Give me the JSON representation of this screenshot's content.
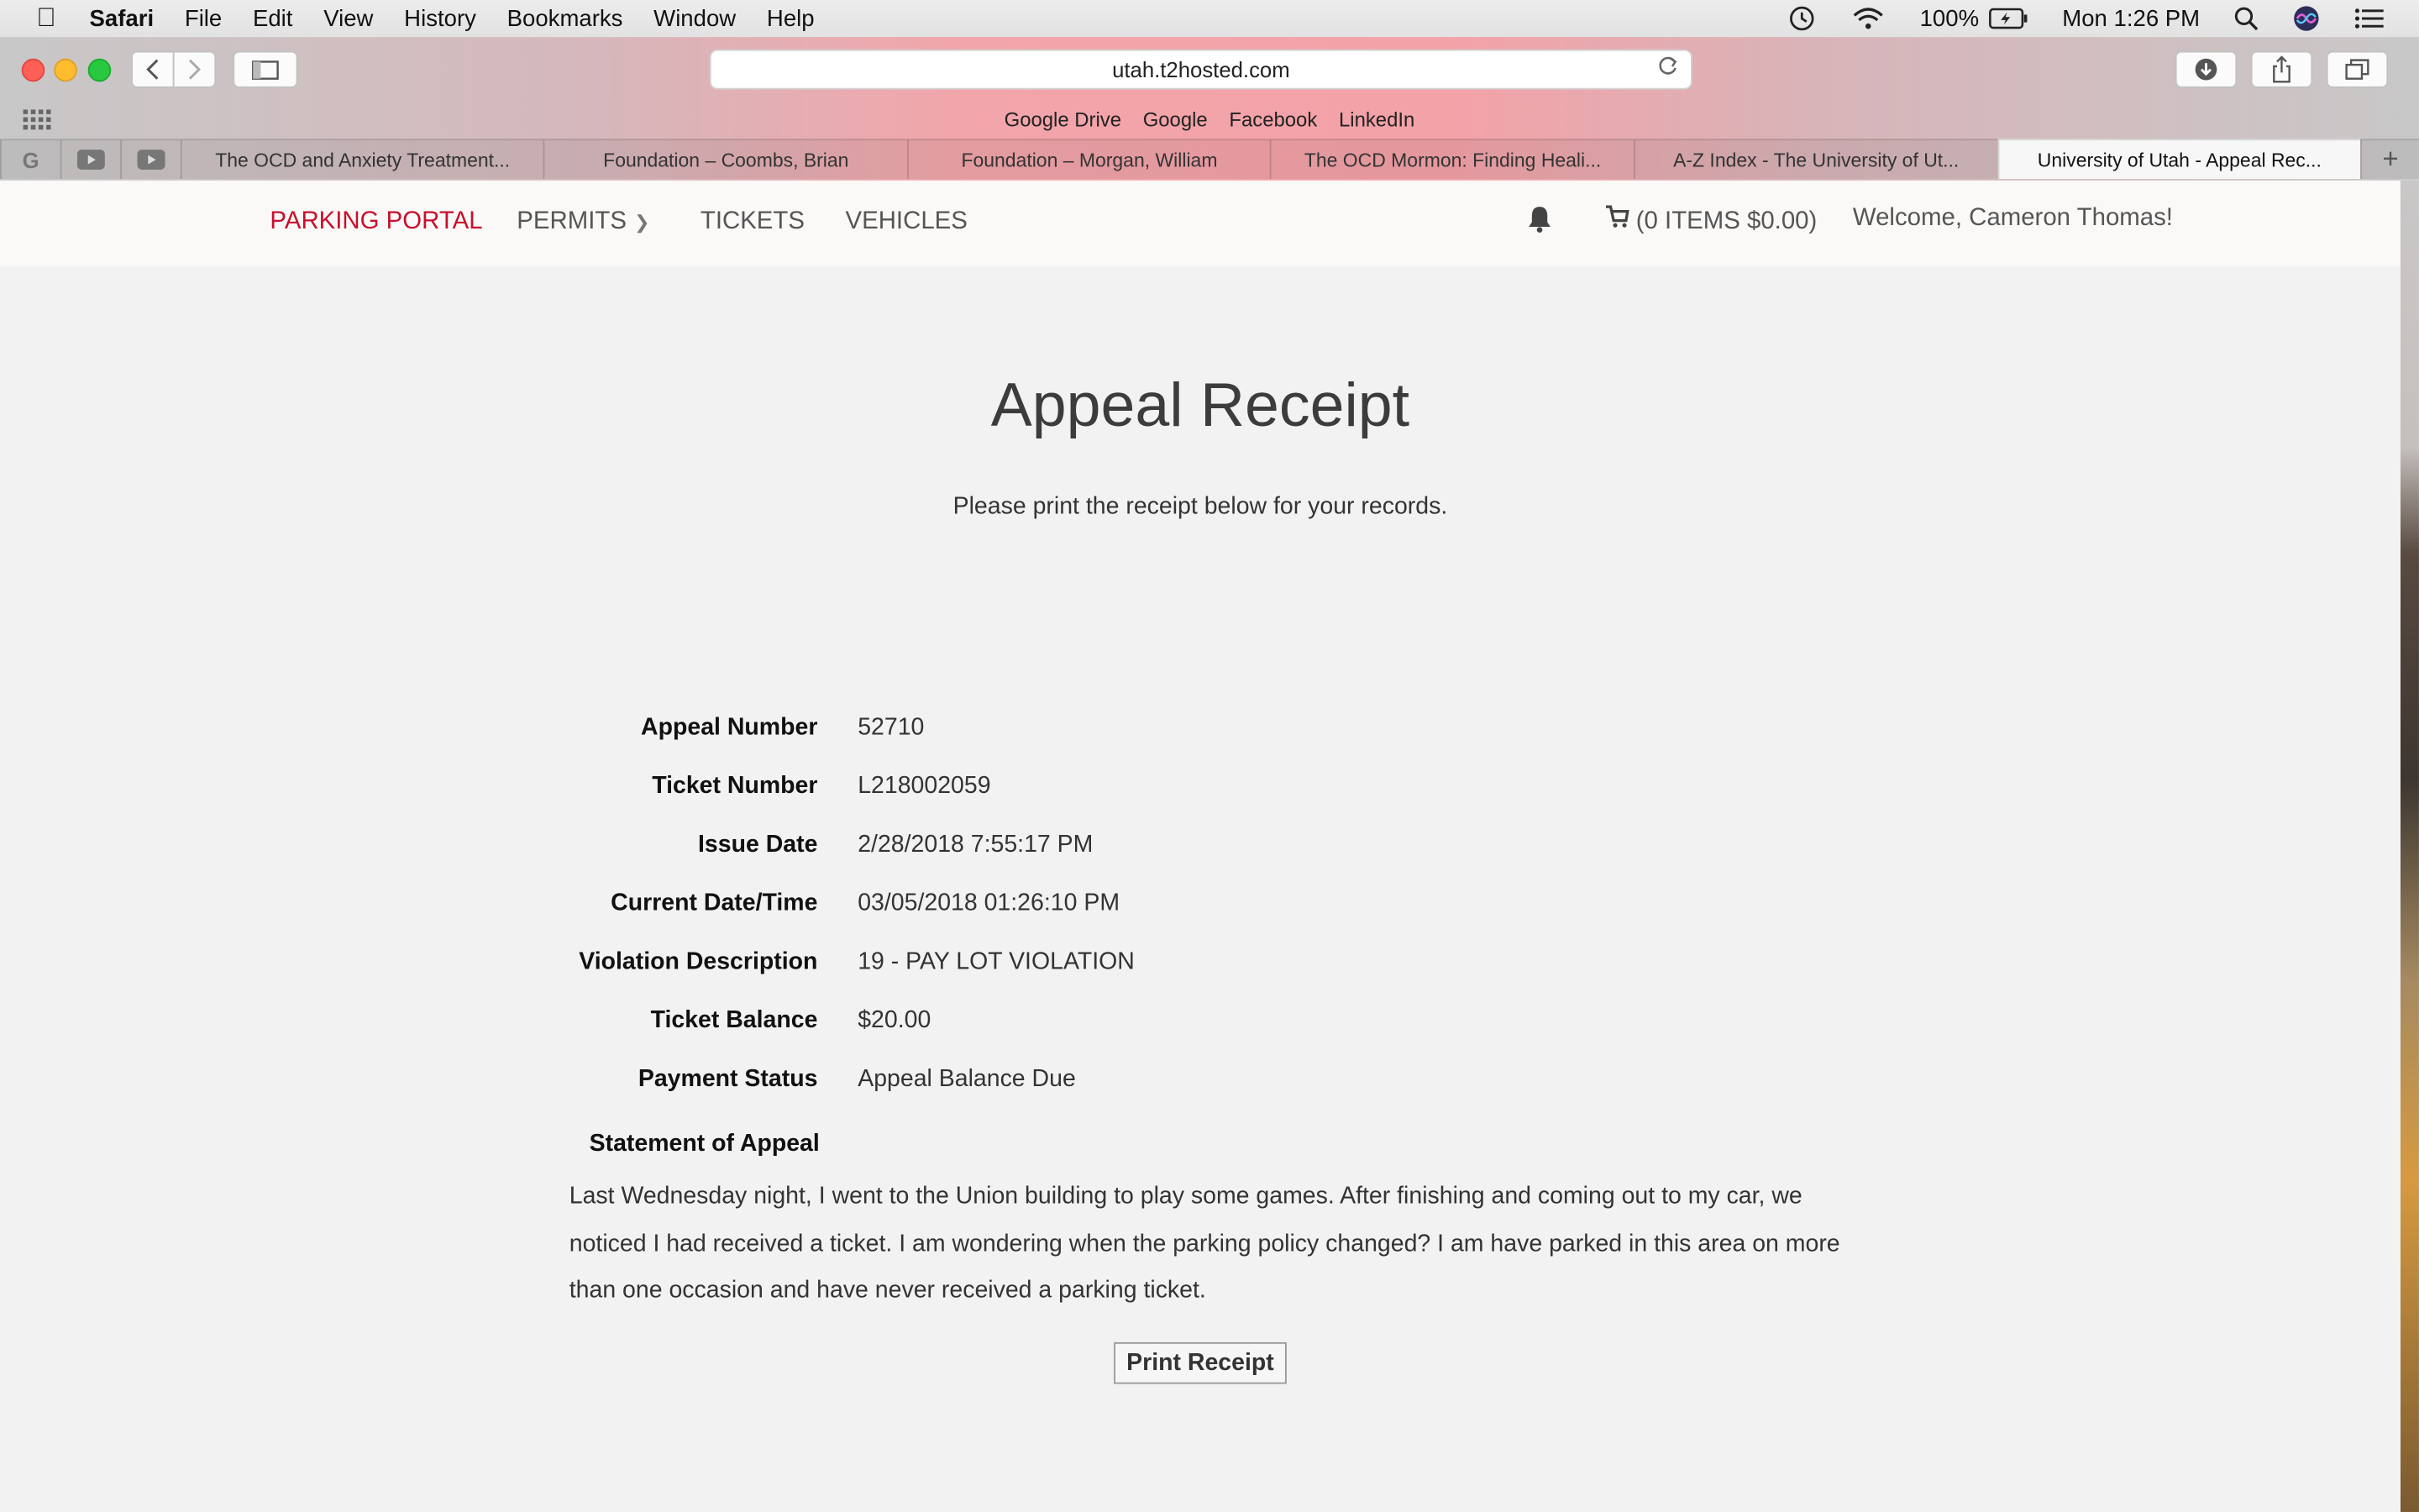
{
  "menubar": {
    "app": "Safari",
    "menus": [
      "File",
      "Edit",
      "View",
      "History",
      "Bookmarks",
      "Window",
      "Help"
    ],
    "battery": "100%",
    "clock": "Mon 1:26 PM"
  },
  "browser": {
    "url": "utah.t2hosted.com",
    "favorites": [
      "Google Drive",
      "Google",
      "Facebook",
      "LinkedIn"
    ],
    "tabs": [
      "The OCD and Anxiety Treatment...",
      "Foundation – Coombs, Brian",
      "Foundation – Morgan, William",
      "The OCD Mormon: Finding Heali...",
      "A-Z Index - The University of Ut...",
      "University of Utah - Appeal Rec..."
    ]
  },
  "nav": {
    "brand": "PARKING PORTAL",
    "permits": "PERMITS",
    "tickets": "TICKETS",
    "vehicles": "VEHICLES",
    "cart": "(0 ITEMS $0.00)",
    "welcome": "Welcome, Cameron Thomas!"
  },
  "page": {
    "title": "Appeal Receipt",
    "subtitle": "Please print the receipt below for your records.",
    "fields": [
      {
        "label": "Appeal Number",
        "value": "52710"
      },
      {
        "label": "Ticket Number",
        "value": "L218002059"
      },
      {
        "label": "Issue Date",
        "value": "2/28/2018 7:55:17 PM"
      },
      {
        "label": "Current Date/Time",
        "value": "03/05/2018 01:26:10 PM"
      },
      {
        "label": "Violation Description",
        "value": "19 - PAY LOT VIOLATION"
      },
      {
        "label": "Ticket Balance",
        "value": "$20.00"
      },
      {
        "label": "Payment Status",
        "value": "Appeal Balance Due"
      }
    ],
    "statement_label": "Statement of Appeal",
    "statement": "Last Wednesday night, I went to the Union building to play some games. After finishing and coming out to my car, we noticed I had received a ticket. I am wondering when the parking policy changed? I am have parked in this area on more than one occasion and have never received a parking ticket.",
    "print_button": "Print Receipt"
  }
}
